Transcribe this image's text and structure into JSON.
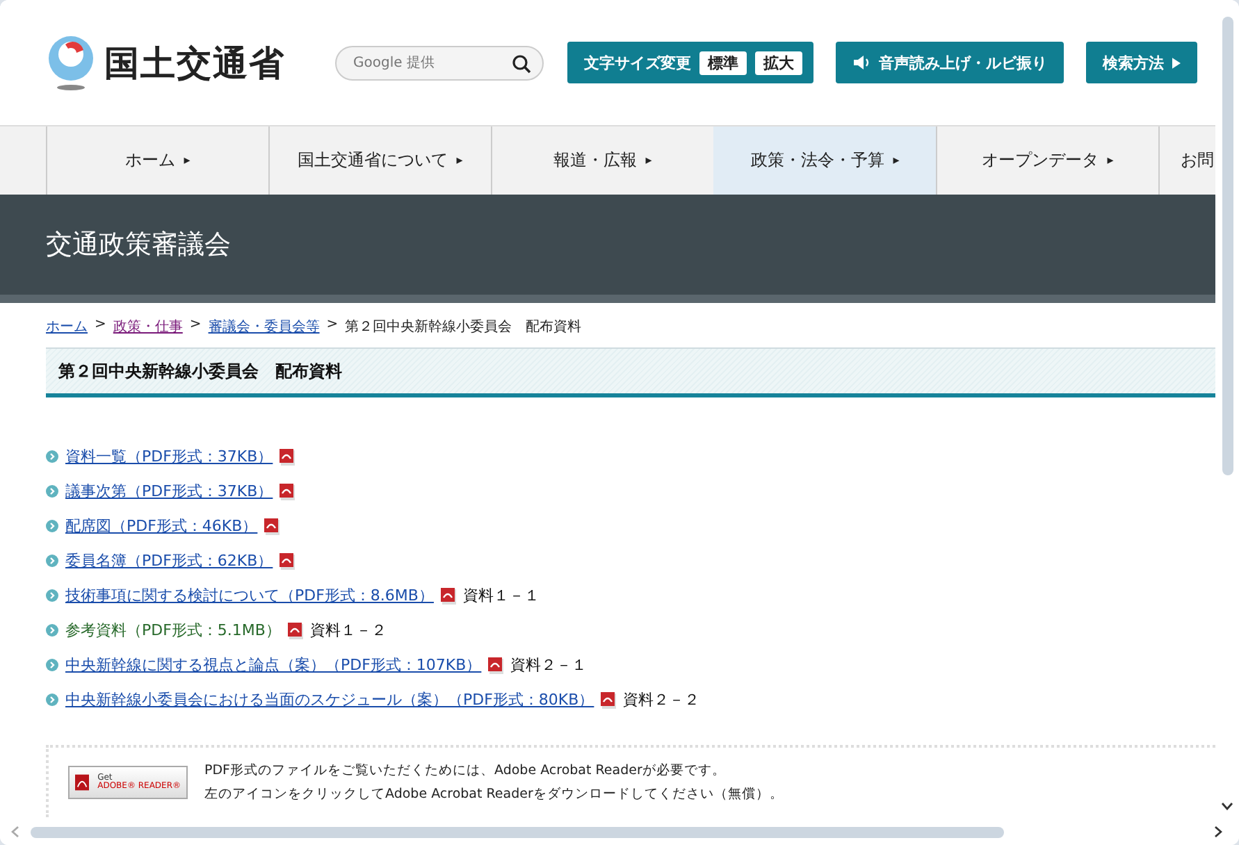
{
  "header": {
    "logo_text": "国土交通省",
    "search": {
      "placeholder": "Google 提供"
    },
    "font_size": {
      "label": "文字サイズ変更",
      "options": [
        "標準",
        "拡大"
      ]
    },
    "speech_button": "音声読み上げ・ルビ振り",
    "search_help_button": "検索方法"
  },
  "nav": [
    {
      "label": "ホーム",
      "selected": false,
      "arrow": "▸"
    },
    {
      "label": "国土交通省について",
      "selected": false,
      "arrow": "▸"
    },
    {
      "label": "報道・広報",
      "selected": false,
      "arrow": "▸"
    },
    {
      "label": "政策・法令・予算",
      "selected": true,
      "arrow": "▸"
    },
    {
      "label": "オープンデータ",
      "selected": false,
      "arrow": "▸"
    },
    {
      "label": "お問",
      "selected": false
    }
  ],
  "banner": {
    "title": "交通政策審議会"
  },
  "breadcrumb": [
    {
      "label": "ホーム",
      "kind": "link",
      "visited": false
    },
    {
      "label": "政策・仕事",
      "kind": "link",
      "visited": true,
      "separator": ">"
    },
    {
      "label": "審議会・委員会等",
      "kind": "link",
      "visited": false,
      "separator": ">"
    },
    {
      "label": "第２回中央新幹線小委員会　配布資料",
      "kind": "current",
      "separator": ">"
    }
  ],
  "page_title": "第２回中央新幹線小委員会　配布資料",
  "documents": [
    {
      "label": "資料一覧（PDF形式：37KB）",
      "visited": false
    },
    {
      "label": "議事次第（PDF形式：37KB）",
      "visited": false
    },
    {
      "label": "配席図（PDF形式：46KB）",
      "visited": false
    },
    {
      "label": "委員名簿（PDF形式：62KB）",
      "visited": false
    },
    {
      "label": "技術事項に関する検討について（PDF形式：8.6MB）",
      "visited": false,
      "note": "資料１－１"
    },
    {
      "label": "参考資料（PDF形式：5.1MB）",
      "visited": true,
      "note": "資料１－２"
    },
    {
      "label": "中央新幹線に関する視点と論点（案）（PDF形式：107KB）",
      "visited": false,
      "note": "資料２－１"
    },
    {
      "label": "中央新幹線小委員会における当面のスケジュール（案）（PDF形式：80KB）",
      "visited": false,
      "note": "資料２－２"
    }
  ],
  "reader_notice": {
    "badge": {
      "line_1": "Get",
      "line_2": "ADOBE® READER®"
    },
    "lines": [
      "PDF形式のファイルをご覧いただくためには、Adobe Acrobat Readerが必要です。",
      "左のアイコンをクリックしてAdobe Acrobat Readerをダウンロードしてください（無償）。"
    ]
  }
}
